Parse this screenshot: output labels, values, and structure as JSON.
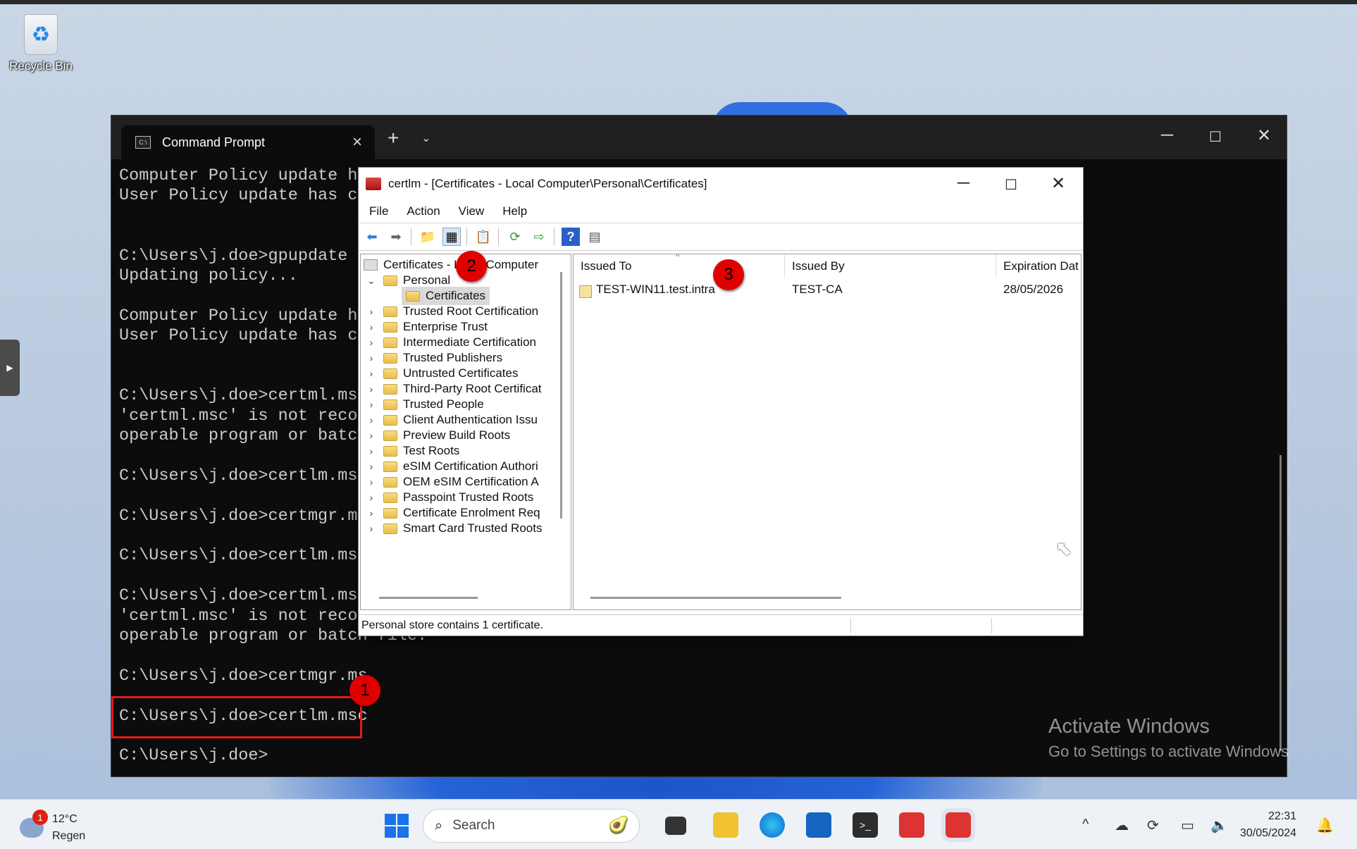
{
  "desktop": {
    "recycle_bin_label": "Recycle Bin",
    "activate_title": "Activate Windows",
    "activate_sub": "Go to Settings to activate Windows"
  },
  "terminal": {
    "tab_title": "Command Prompt",
    "lines": [
      "Computer Policy update ha",
      "User Policy update has co",
      "",
      "",
      "C:\\Users\\j.doe>gpupdate /",
      "Updating policy...",
      "",
      "Computer Policy update ha",
      "User Policy update has co",
      "",
      "",
      "C:\\Users\\j.doe>certml.msc",
      "'certml.msc' is not recog",
      "operable program or batch",
      "",
      "C:\\Users\\j.doe>certlm.msc",
      "",
      "C:\\Users\\j.doe>certmgr.ms",
      "",
      "C:\\Users\\j.doe>certlm.msc",
      "",
      "C:\\Users\\j.doe>certml.msc",
      "'certml.msc' is not recog",
      "operable program or batch file.",
      "",
      "C:\\Users\\j.doe>certmgr.ms",
      "",
      "C:\\Users\\j.doe>certlm.msc",
      "",
      "C:\\Users\\j.doe>"
    ]
  },
  "mmc": {
    "title": "certlm - [Certificates - Local Computer\\Personal\\Certificates]",
    "menu": [
      "File",
      "Action",
      "View",
      "Help"
    ],
    "tree": {
      "root": "Certificates - Local Computer",
      "personal": "Personal",
      "certificates": "Certificates",
      "stores": [
        "Trusted Root Certification",
        "Enterprise Trust",
        "Intermediate Certification",
        "Trusted Publishers",
        "Untrusted Certificates",
        "Third-Party Root Certificat",
        "Trusted People",
        "Client Authentication Issu",
        "Preview Build Roots",
        "Test Roots",
        "eSIM Certification Authori",
        "OEM eSIM Certification A",
        "Passpoint Trusted Roots",
        "Certificate Enrolment Req",
        "Smart Card Trusted Roots"
      ]
    },
    "columns": [
      "Issued To",
      "Issued By",
      "Expiration Dat"
    ],
    "rows": [
      {
        "issued_to": "TEST-WIN11.test.intra",
        "issued_by": "TEST-CA",
        "expiration": "28/05/2026"
      }
    ],
    "status": "Personal store contains 1 certificate."
  },
  "badges": [
    "1",
    "2",
    "3"
  ],
  "taskbar": {
    "weather_temp": "12°C",
    "weather_desc": "Regen",
    "weather_badge": "1",
    "search_placeholder": "Search",
    "time": "22:31",
    "date": "30/05/2024"
  }
}
